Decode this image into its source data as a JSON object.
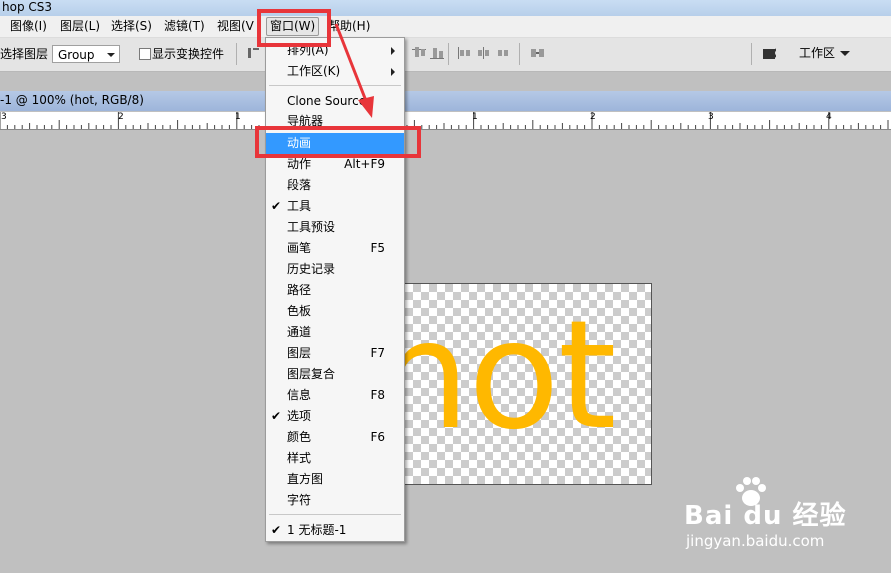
{
  "app": {
    "title": "hop CS3"
  },
  "menubar": {
    "items": [
      {
        "label": "图像(I)"
      },
      {
        "label": "图层(L)"
      },
      {
        "label": "选择(S)"
      },
      {
        "label": "滤镜(T)"
      },
      {
        "label": "视图(V"
      },
      {
        "label": "窗口(W)"
      },
      {
        "label": "帮助(H)"
      }
    ]
  },
  "options": {
    "select_layer_label": "选择图层",
    "group_value": "Group",
    "show_transform_label": "显示变换控件",
    "workspace_label": "工作区"
  },
  "document": {
    "tab_title": "-1 @ 100% (hot, RGB/8)"
  },
  "ruler": {
    "labels": [
      "3",
      "2",
      "1",
      "1",
      "2",
      "3",
      "4"
    ]
  },
  "canvas": {
    "text": "hot",
    "text_color": "#ffb800"
  },
  "window_menu": {
    "items": [
      {
        "label": "排列(A)",
        "submenu": true
      },
      {
        "label": "工作区(K)",
        "submenu": true
      },
      {
        "label": "Clone Source"
      },
      {
        "label": "导航器"
      },
      {
        "label": "动画",
        "highlighted": true
      },
      {
        "label": "动作",
        "shortcut": "Alt+F9"
      },
      {
        "label": "段落"
      },
      {
        "label": "工具",
        "checked": true
      },
      {
        "label": "工具预设"
      },
      {
        "label": "画笔",
        "shortcut": "F5"
      },
      {
        "label": "历史记录"
      },
      {
        "label": "路径"
      },
      {
        "label": "色板"
      },
      {
        "label": "通道"
      },
      {
        "label": "图层",
        "shortcut": "F7"
      },
      {
        "label": "图层复合"
      },
      {
        "label": "信息",
        "shortcut": "F8"
      },
      {
        "label": "选项",
        "checked": true
      },
      {
        "label": "颜色",
        "shortcut": "F6"
      },
      {
        "label": "样式"
      },
      {
        "label": "直方图"
      },
      {
        "label": "字符"
      },
      {
        "label": "1 无标题-1",
        "checked": true
      }
    ]
  },
  "colors": {
    "highlight": "#3399ff",
    "annotation": "#e8353a",
    "text_hot": "#ffb800"
  },
  "watermark": {
    "brand": "Bai du 经验",
    "url": "jingyan.baidu.com"
  }
}
